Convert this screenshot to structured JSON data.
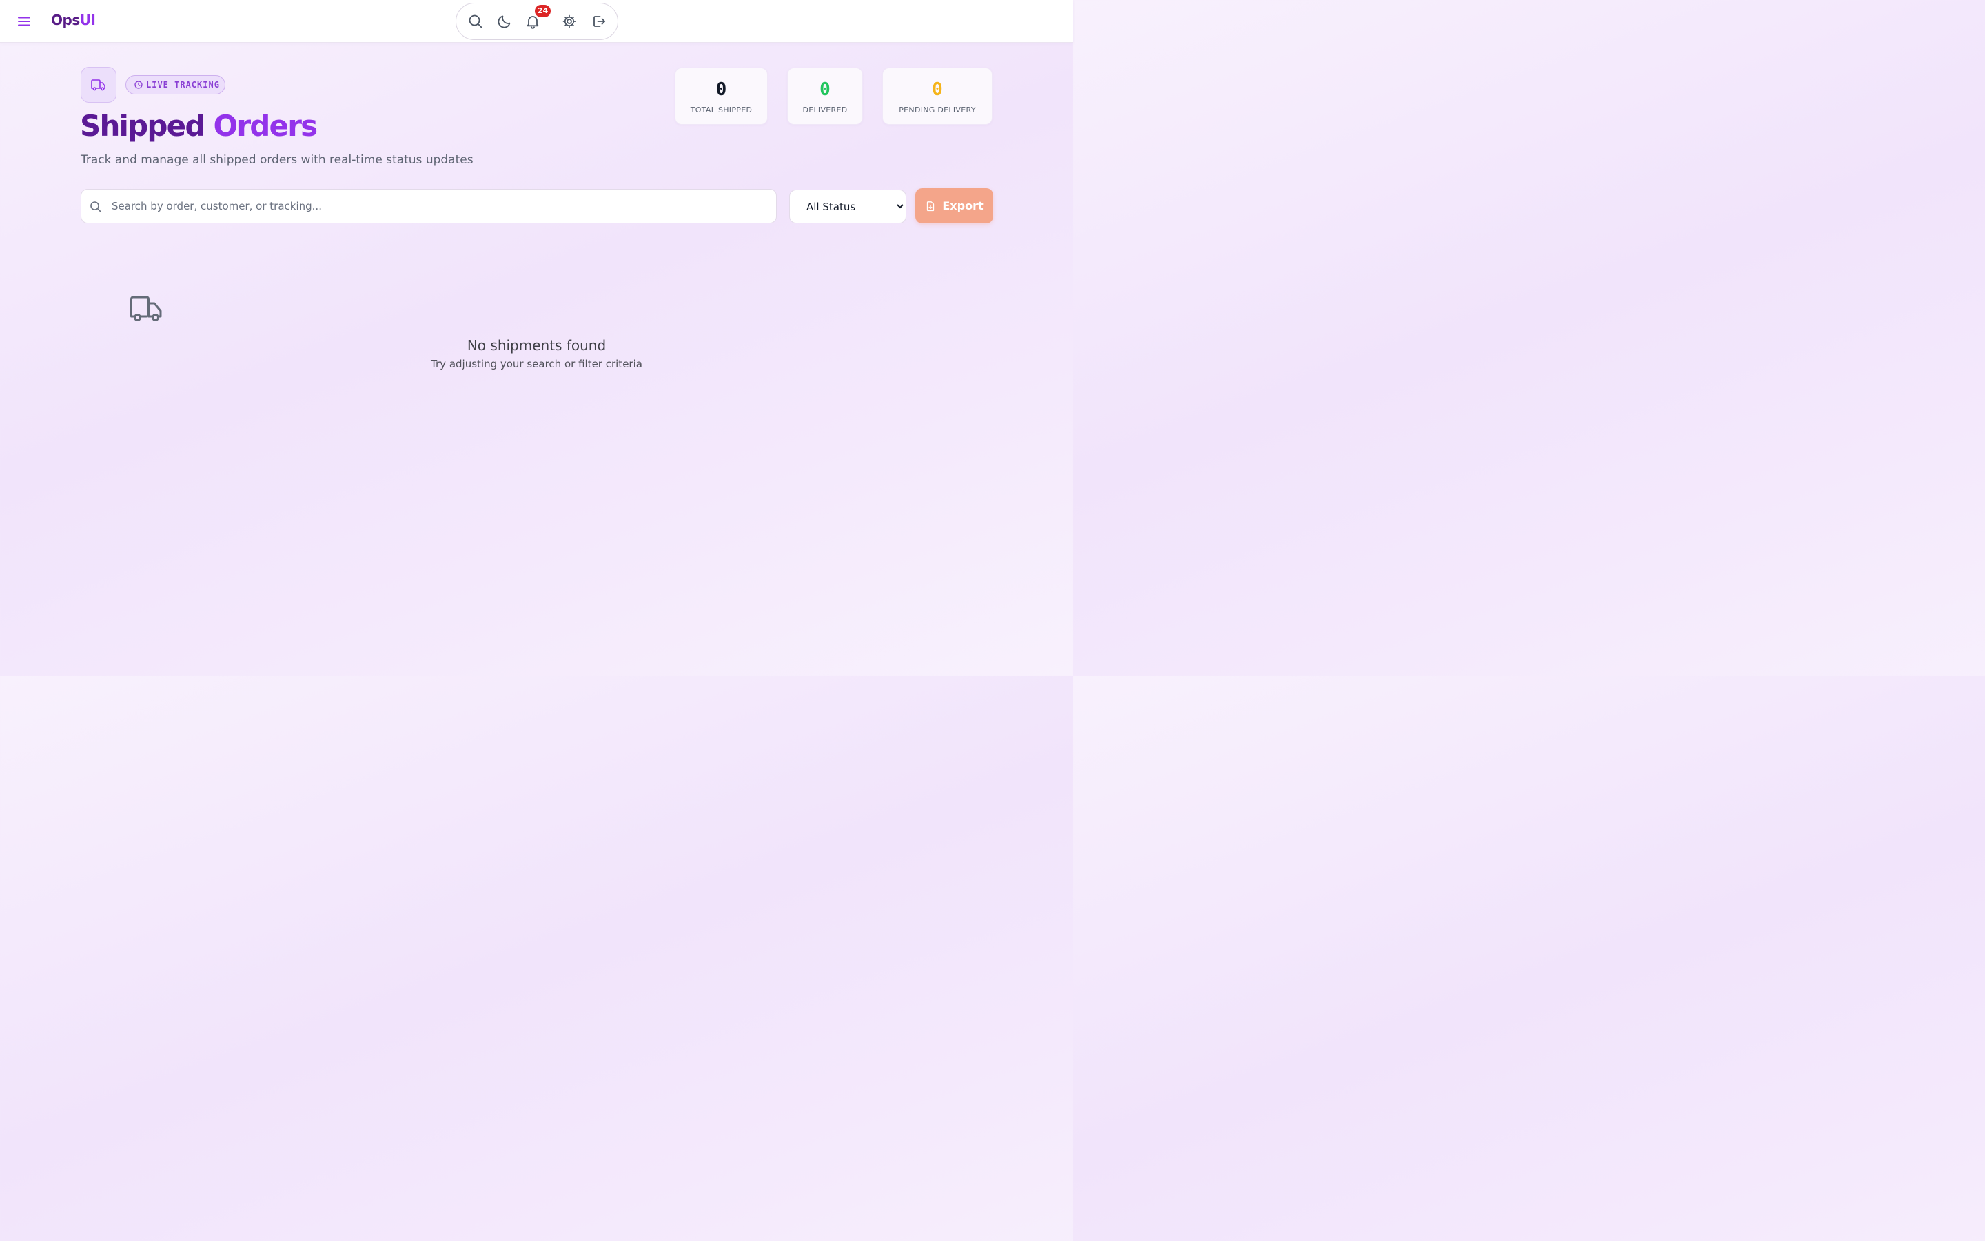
{
  "app": {
    "brand_primary": "Ops",
    "brand_accent": "UI"
  },
  "toolbar": {
    "icons": [
      "search-icon",
      "moon-icon",
      "bell-icon",
      "gear-icon",
      "logout-icon"
    ],
    "notification_count": "24"
  },
  "header": {
    "icon": "truck-icon",
    "badge": "LIVE TRACKING",
    "title_part1": "Shipped",
    "title_part2": "Orders",
    "subtitle": "Track and manage all shipped orders with real-time status updates"
  },
  "stats": [
    {
      "value": "0",
      "label": "TOTAL SHIPPED",
      "color": "#111827"
    },
    {
      "value": "0",
      "label": "DELIVERED",
      "color": "#22c55e"
    },
    {
      "value": "0",
      "label": "PENDING DELIVERY",
      "color": "#f5b41a"
    }
  ],
  "filters": {
    "search_placeholder": "Search by order, customer, or tracking...",
    "search_value": "",
    "status_selected": "All Status",
    "export_label": "Export"
  },
  "empty_state": {
    "icon": "truck-icon",
    "title": "No shipments found",
    "message": "Try adjusting your search or filter criteria"
  },
  "colors": {
    "brand_dark": "#581c87",
    "brand_accent": "#9333ea",
    "export_button": "#f4a58a",
    "badge_red": "#dc2626"
  }
}
